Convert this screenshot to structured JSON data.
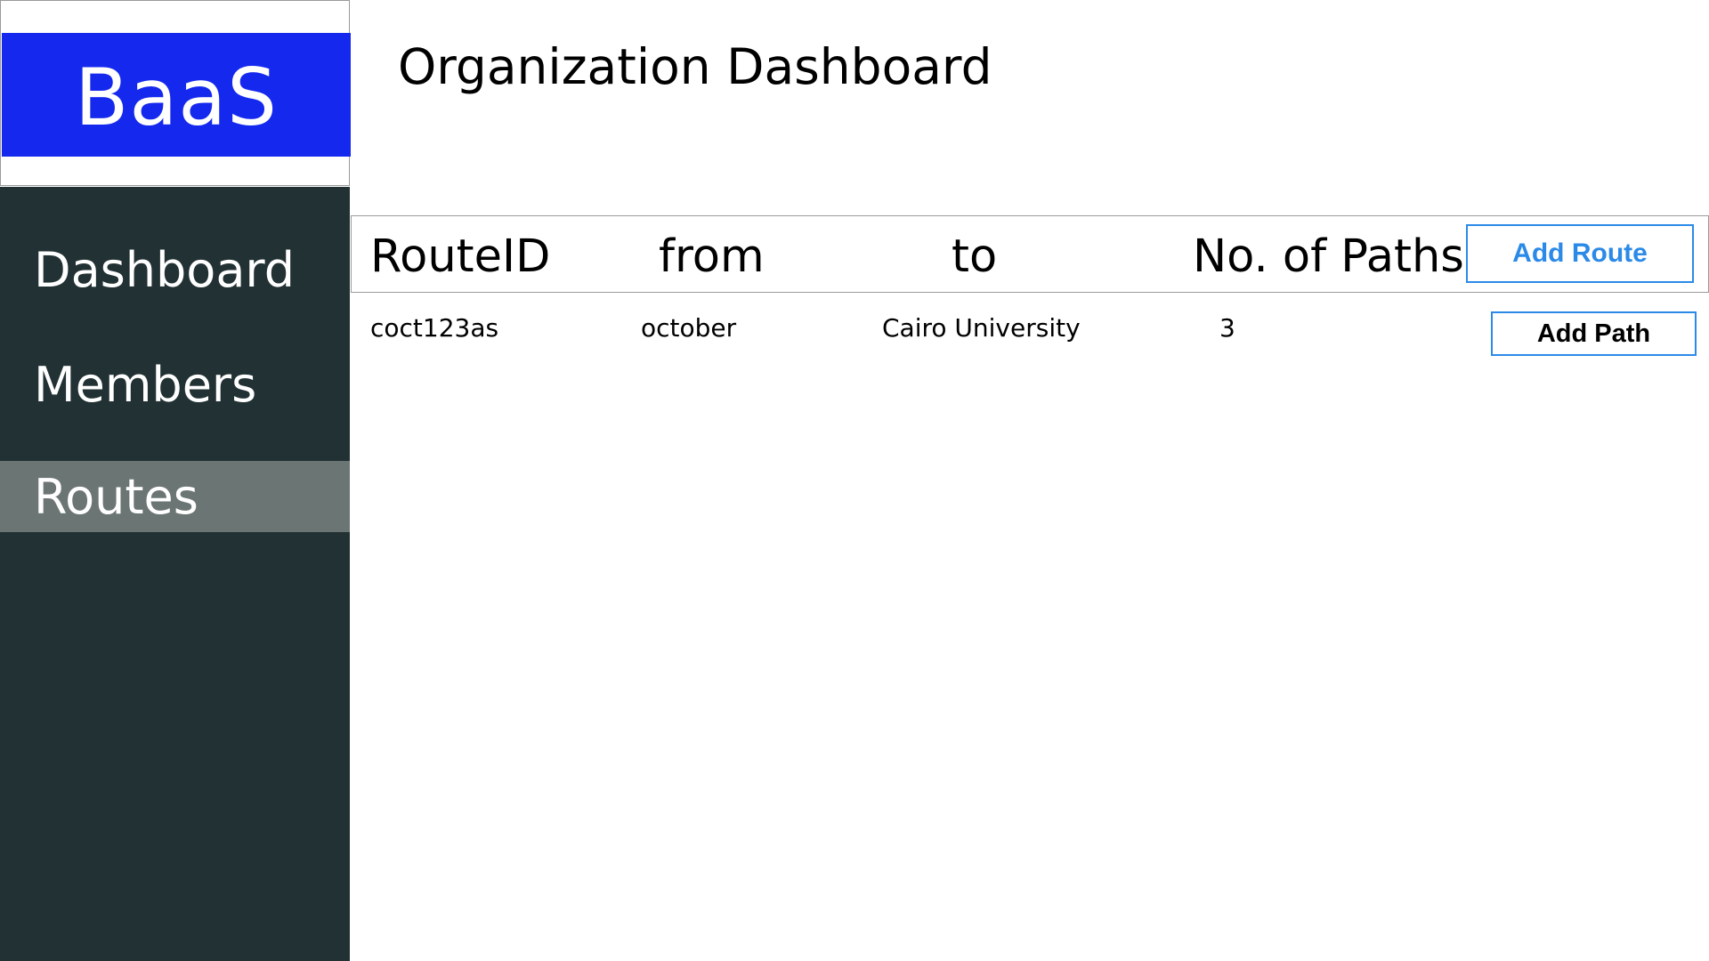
{
  "app": {
    "logo_text": "BaaS",
    "brand_color": "#1529ee"
  },
  "sidebar": {
    "background_color": "#223134",
    "active_color": "#6b7574",
    "items": [
      {
        "label": "Dashboard",
        "active": false
      },
      {
        "label": "Members",
        "active": false
      },
      {
        "label": "Routes",
        "active": true
      }
    ]
  },
  "main": {
    "title": "Organization Dashboard",
    "table": {
      "columns": [
        "RouteID",
        "from",
        "to",
        "No. of Paths"
      ],
      "add_route_label": "Add Route",
      "rows": [
        {
          "route_id": "coct123as",
          "from": "october",
          "to": "Cairo University",
          "paths": "3",
          "action_label": "Add Path"
        }
      ]
    },
    "accent_color": "#2b8ae8"
  }
}
